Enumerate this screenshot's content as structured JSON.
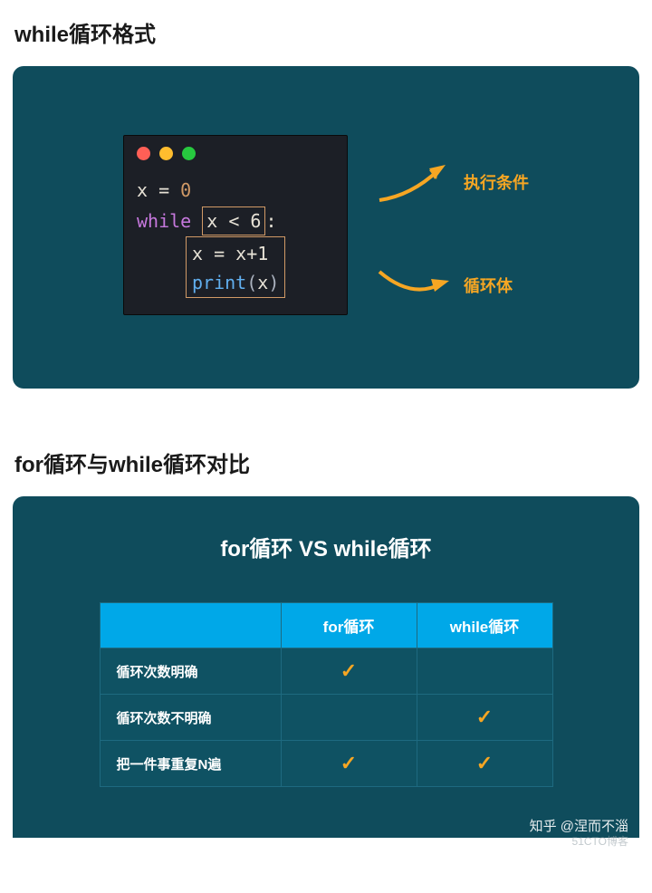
{
  "section1": {
    "title": "while循环格式",
    "code": {
      "line1_var": "x",
      "line1_eq": " = ",
      "line1_val": "0",
      "line2_kw": "while",
      "line2_cond": "x < 6",
      "line2_colon": ":",
      "line3_body": "x = x+1",
      "line4_fn": "print",
      "line4_arg": "x"
    },
    "labels": {
      "condition": "执行条件",
      "body": "循环体"
    }
  },
  "section2": {
    "title": "for循环与while循环对比",
    "vs_title": "for循环  VS  while循环",
    "table": {
      "headers": [
        "",
        "for循环",
        "while循环"
      ],
      "rows": [
        {
          "label": "循环次数明确",
          "for": true,
          "while": false
        },
        {
          "label": "循环次数不明确",
          "for": false,
          "while": true
        },
        {
          "label": "把一件事重复N遍",
          "for": true,
          "while": true
        }
      ]
    }
  },
  "watermark": "知乎 @涅而不淄",
  "watermark_sub": "51CTO博客"
}
